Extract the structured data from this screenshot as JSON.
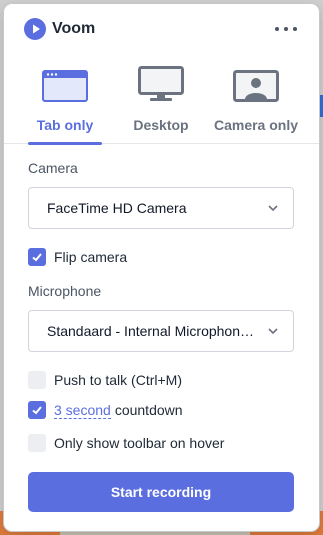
{
  "app": {
    "title": "Voom"
  },
  "header": {
    "more_icon": "more-horizontal-icon"
  },
  "tabs": [
    {
      "label": "Tab only",
      "icon": "browser-tab-icon",
      "active": true
    },
    {
      "label": "Desktop",
      "icon": "monitor-icon",
      "active": false
    },
    {
      "label": "Camera only",
      "icon": "camera-user-icon",
      "active": false
    }
  ],
  "camera": {
    "label": "Camera",
    "selected": "FaceTime HD Camera"
  },
  "flip_camera": {
    "label": "Flip camera",
    "checked": true
  },
  "microphone": {
    "label": "Microphone",
    "selected": "Standaard - Internal Microphone (Built-in)"
  },
  "options": {
    "push_to_talk": {
      "label": "Push to talk (Ctrl+M)",
      "checked": false
    },
    "countdown": {
      "value": "3 second",
      "label": "countdown",
      "checked": true
    },
    "toolbar_hover": {
      "label": "Only show toolbar on hover",
      "checked": false
    }
  },
  "start_button": {
    "label": "Start recording"
  },
  "colors": {
    "accent": "#5b6ee0",
    "text": "#1f2937",
    "muted": "#6b7280"
  }
}
